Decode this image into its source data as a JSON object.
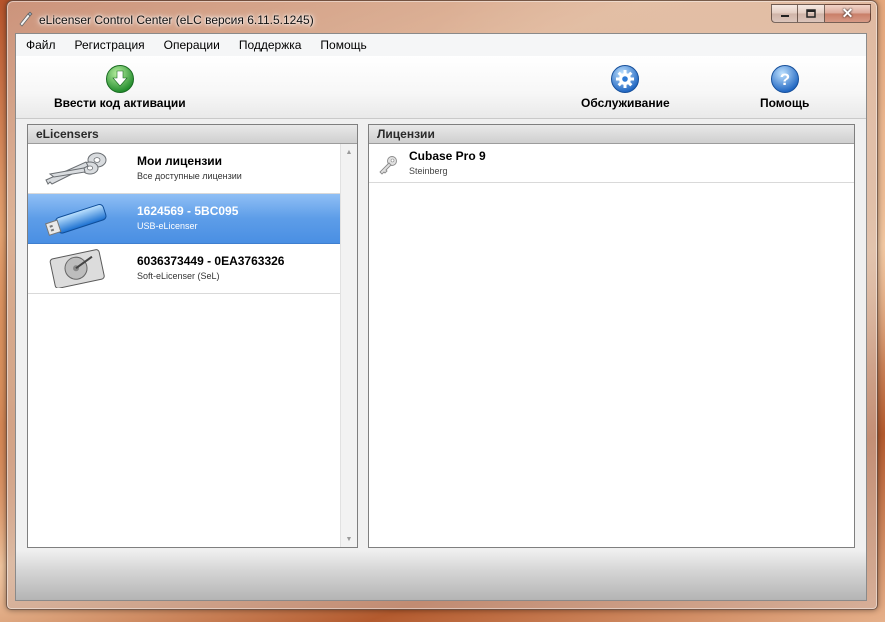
{
  "window": {
    "title": "eLicenser Control Center (eLC версия 6.11.5.1245)",
    "close_label": "✕",
    "minimize_icon": "minimize-icon",
    "maximize_icon": "maximize-icon"
  },
  "menu": [
    {
      "label": "Файл"
    },
    {
      "label": "Регистрация"
    },
    {
      "label": "Операции"
    },
    {
      "label": "Поддержка"
    },
    {
      "label": "Помощь"
    }
  ],
  "toolbar": {
    "activate_label": "Ввести код активации",
    "maintenance_label": "Обслуживание",
    "help_label": "Помощь",
    "accent_green": "#2fa83a",
    "accent_blue": "#2f7bd6"
  },
  "elicensers": {
    "header": "eLicensers",
    "items": [
      {
        "title": "Мои лицензии",
        "subtitle": "Все доступные лицензии",
        "icon": "keys-icon",
        "selected": false
      },
      {
        "title": "1624569 - 5BC095",
        "subtitle": "USB-eLicenser",
        "icon": "usb-stick-icon",
        "selected": true
      },
      {
        "title": "6036373449 - 0EA3763326",
        "subtitle": "Soft-eLicenser (SeL)",
        "icon": "hard-drive-icon",
        "selected": false
      }
    ]
  },
  "licenses": {
    "header": "Лицензии",
    "items": [
      {
        "title": "Cubase Pro 9",
        "subtitle": "Steinberg",
        "icon": "key-icon"
      }
    ]
  },
  "colors": {
    "selection": "#4a8fe3"
  }
}
